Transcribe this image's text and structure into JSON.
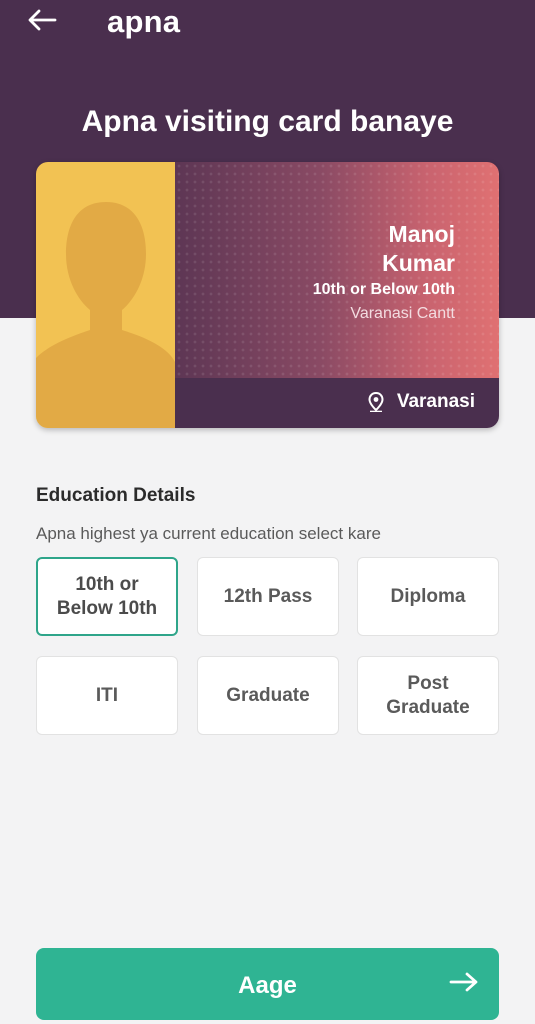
{
  "header": {
    "brand": "apna",
    "icons": {
      "back": "back-arrow-icon"
    }
  },
  "hero": {
    "title": "Apna visiting card banaye"
  },
  "card": {
    "name": "Manoj Kumar",
    "education": "10th or Below 10th",
    "area": "Varanasi Cantt",
    "city": "Varanasi",
    "icons": {
      "photo": "avatar-silhouette-icon",
      "location": "location-pin-icon"
    }
  },
  "education": {
    "title": "Education Details",
    "subtitle": "Apna highest ya current education select kare",
    "selected": "10th or Below 10th",
    "options": [
      "10th or Below 10th",
      "12th Pass",
      "Diploma",
      "ITI",
      "Graduate",
      "Post Graduate"
    ]
  },
  "footer": {
    "next_label": "Aage",
    "icons": {
      "next": "arrow-right-icon"
    }
  },
  "colors": {
    "header_bg": "#4a2f4e",
    "accent": "#2fb493",
    "photo_bg": "#f2c253",
    "card_gradient_end": "#e07172"
  }
}
